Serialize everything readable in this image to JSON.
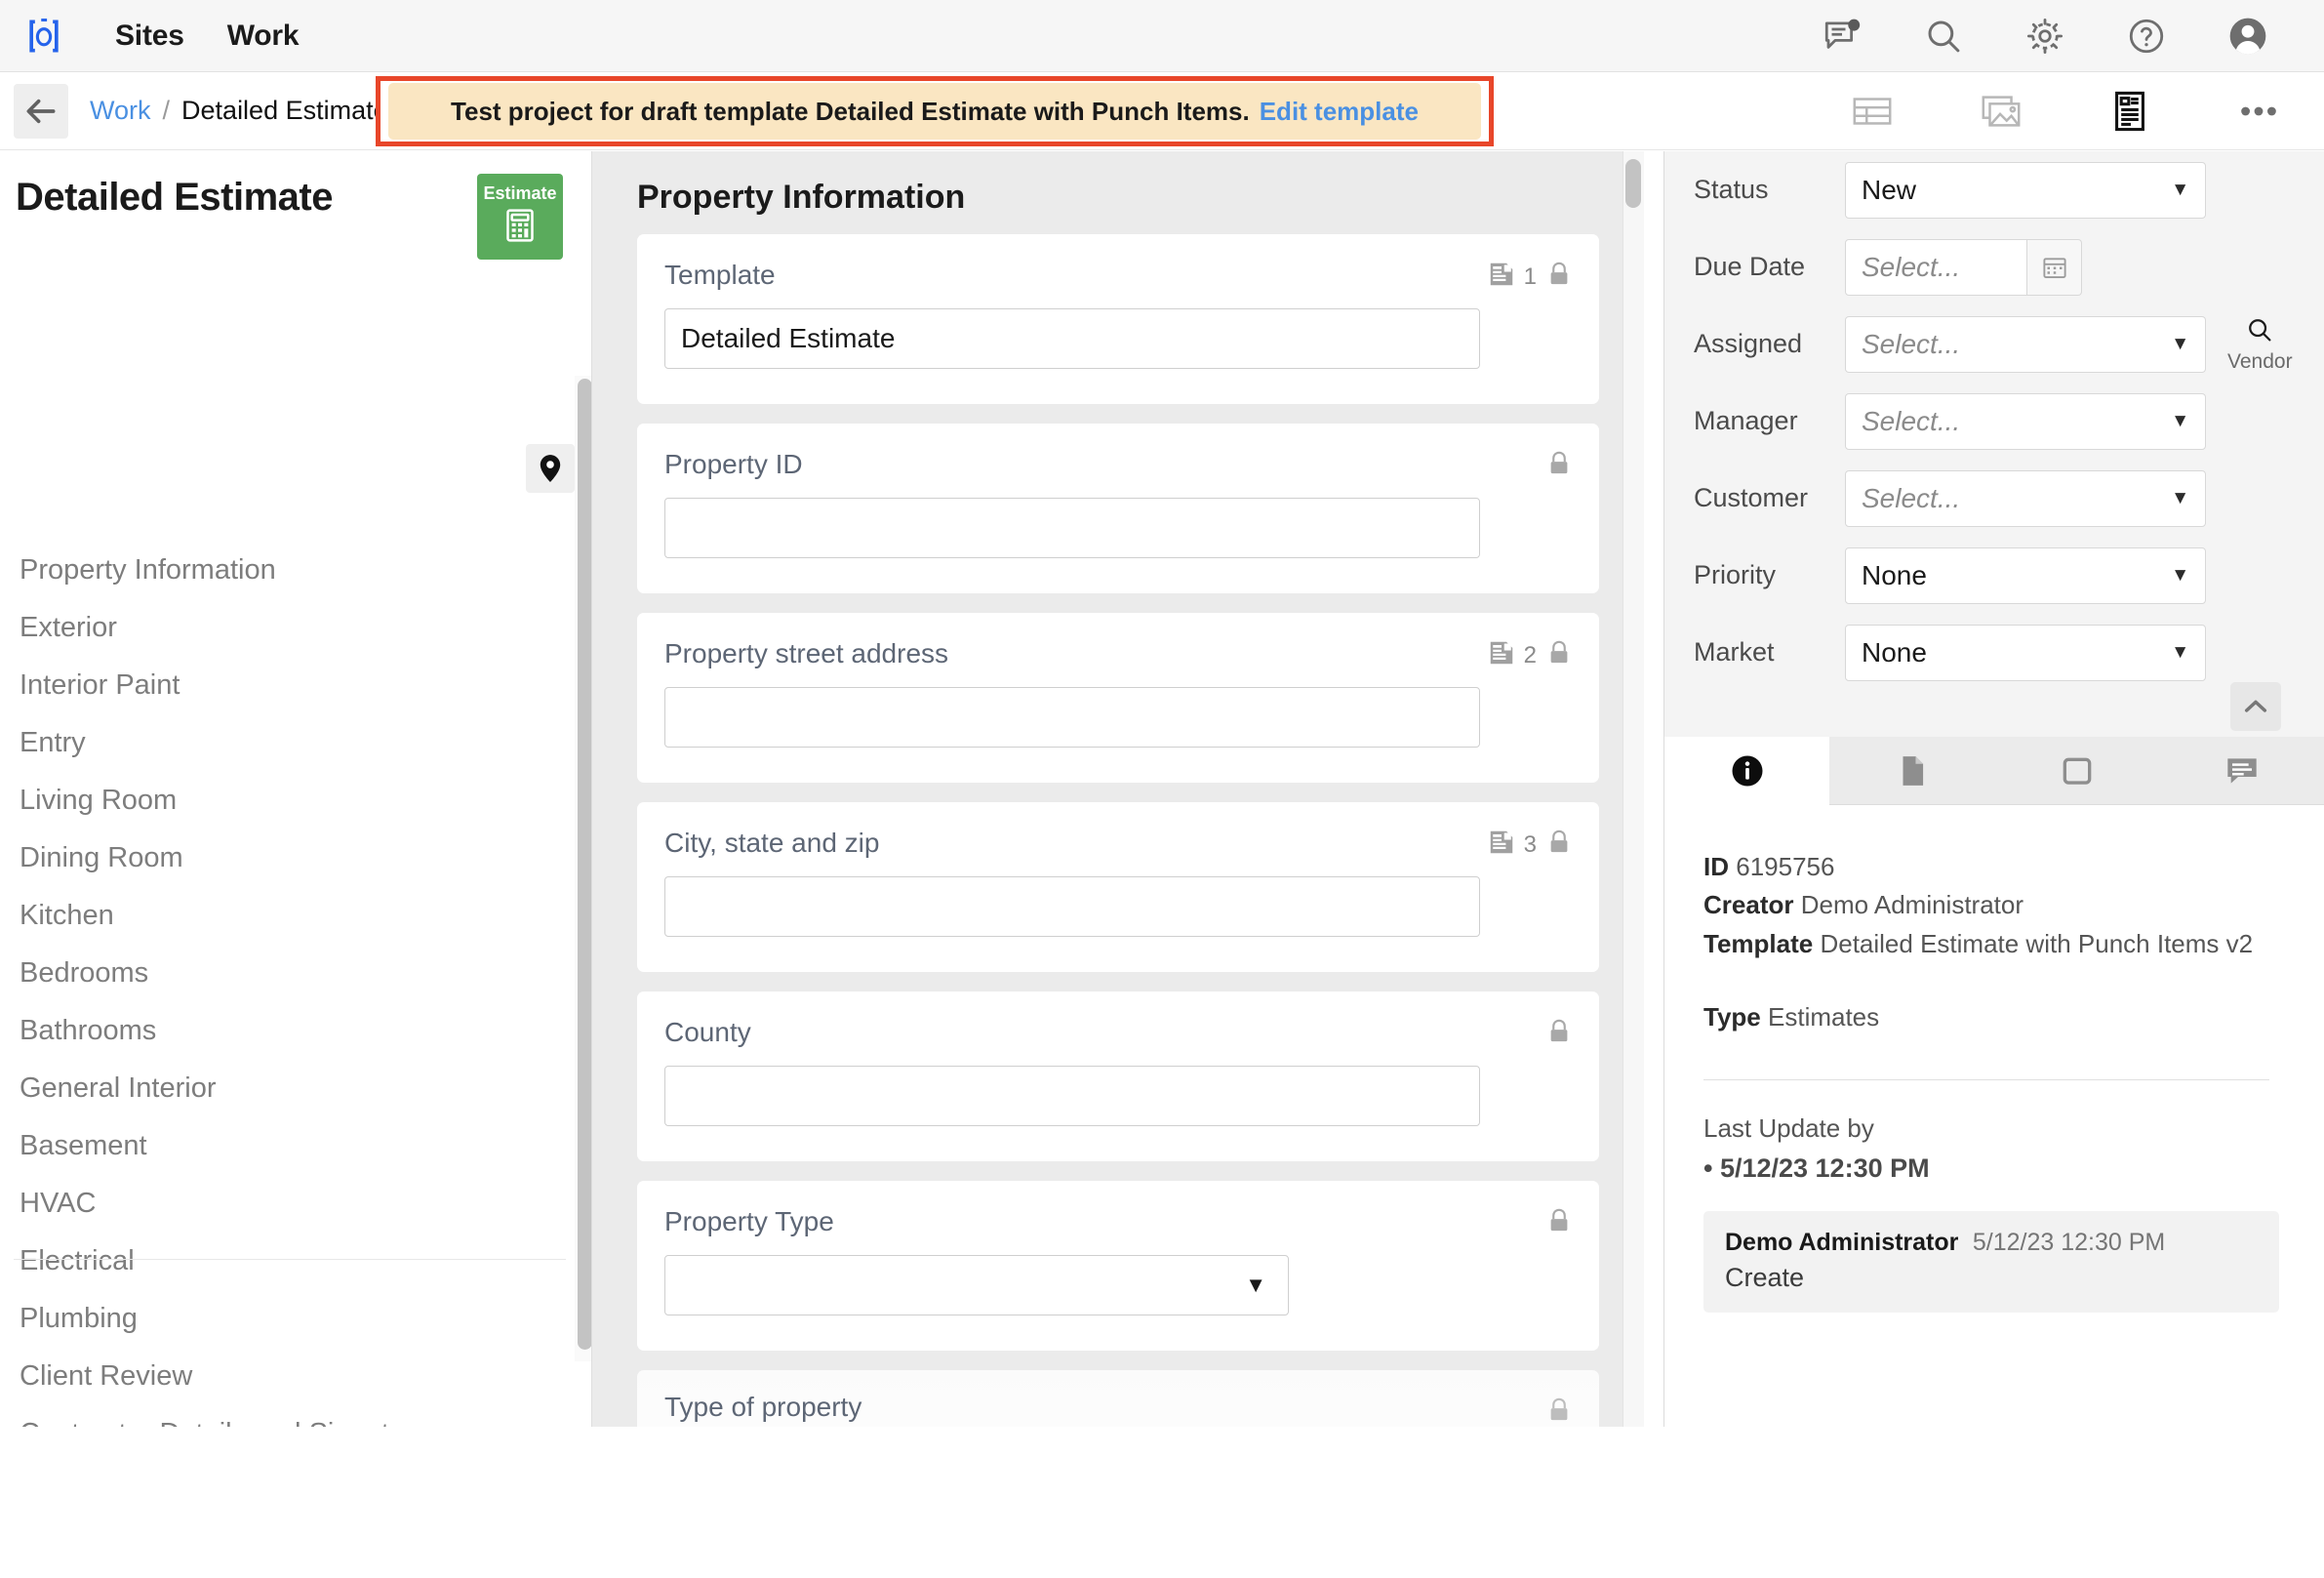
{
  "topbar": {
    "brand_icon": "bracket-o-logo",
    "nav": [
      {
        "label": "Sites",
        "name": "nav-sites"
      },
      {
        "label": "Work",
        "name": "nav-work"
      }
    ],
    "icons": [
      {
        "name": "messages-icon",
        "badge": true
      },
      {
        "name": "search-icon",
        "badge": false
      },
      {
        "name": "gear-icon",
        "badge": false
      },
      {
        "name": "help-icon",
        "badge": false
      },
      {
        "name": "avatar-icon",
        "badge": false
      }
    ]
  },
  "breadcrumb": {
    "back_icon": "arrow-left-icon",
    "parent": "Work",
    "separator": "/",
    "current": "Detailed Estimate"
  },
  "banner": {
    "text": "Test project for draft template Detailed Estimate with Punch Items.",
    "link": "Edit template",
    "border_color": "#e8462a",
    "background_color": "#fae6c2"
  },
  "view_toolbar": [
    {
      "name": "table-view-icon",
      "active": false
    },
    {
      "name": "gallery-view-icon",
      "active": false
    },
    {
      "name": "form-view-icon",
      "active": true
    },
    {
      "name": "more-options-icon",
      "active": false
    }
  ],
  "sidebar": {
    "title": "Detailed Estimate",
    "estimate_badge": {
      "label": "Estimate",
      "icon": "calculator-icon",
      "color": "#5aab5c"
    },
    "pin_icon": "location-pin-icon",
    "items": [
      {
        "label": "Property Information"
      },
      {
        "label": "Exterior"
      },
      {
        "label": "Interior Paint"
      },
      {
        "label": "Entry"
      },
      {
        "label": "Living Room"
      },
      {
        "label": "Dining Room"
      },
      {
        "label": "Kitchen"
      },
      {
        "label": "Bedrooms"
      },
      {
        "label": "Bathrooms"
      },
      {
        "label": "General Interior"
      },
      {
        "label": "Basement"
      },
      {
        "label": "HVAC"
      },
      {
        "label": "Electrical"
      },
      {
        "label": "Plumbing"
      },
      {
        "label": "Client Review"
      },
      {
        "label": "Contractor Details and Signature"
      }
    ]
  },
  "main": {
    "section_title": "Property Information",
    "fields": [
      {
        "label": "Template",
        "type": "text",
        "value": "Detailed Estimate",
        "placeholder": "",
        "note_count": "1",
        "locked": true
      },
      {
        "label": "Property ID",
        "type": "text",
        "value": "",
        "placeholder": "",
        "note_count": "",
        "locked": true
      },
      {
        "label": "Property street address",
        "type": "text",
        "value": "",
        "placeholder": "",
        "note_count": "2",
        "locked": true
      },
      {
        "label": "City, state and zip",
        "type": "text",
        "value": "",
        "placeholder": "",
        "note_count": "3",
        "locked": true
      },
      {
        "label": "County",
        "type": "text",
        "value": "",
        "placeholder": "",
        "note_count": "",
        "locked": true
      },
      {
        "label": "Property Type",
        "type": "select",
        "value": "",
        "placeholder": "",
        "note_count": "",
        "locked": true
      }
    ],
    "partial_field_label": "Type of property"
  },
  "rightpanel": {
    "properties": [
      {
        "label": "Status",
        "type": "select",
        "value": "New",
        "placeholder": ""
      },
      {
        "label": "Due Date",
        "type": "date",
        "value": "",
        "placeholder": "Select..."
      },
      {
        "label": "Assigned",
        "type": "select",
        "value": "",
        "placeholder": "Select...",
        "extra": {
          "icon": "search-icon",
          "label": "Vendor"
        }
      },
      {
        "label": "Manager",
        "type": "select",
        "value": "",
        "placeholder": "Select..."
      },
      {
        "label": "Customer",
        "type": "select",
        "value": "",
        "placeholder": "Select..."
      },
      {
        "label": "Priority",
        "type": "select",
        "value": "None",
        "placeholder": ""
      },
      {
        "label": "Market",
        "type": "select",
        "value": "None",
        "placeholder": ""
      }
    ],
    "collapse_icon": "chevron-up-icon",
    "tabs": [
      {
        "name": "tab-info",
        "icon": "info-icon",
        "active": true
      },
      {
        "name": "tab-documents",
        "icon": "document-icon",
        "active": false
      },
      {
        "name": "tab-board",
        "icon": "window-icon",
        "active": false
      },
      {
        "name": "tab-comments",
        "icon": "comment-icon",
        "active": false
      }
    ],
    "info": {
      "id_label": "ID",
      "id_value": "6195756",
      "creator_label": "Creator",
      "creator_value": "Demo Administrator",
      "template_label": "Template",
      "template_value": "Detailed Estimate with Punch Items v2",
      "type_label": "Type",
      "type_value": "Estimates"
    },
    "last_update": {
      "title": "Last Update by",
      "date": "• 5/12/23 12:30 PM",
      "entry_who": "Demo Administrator",
      "entry_when": "5/12/23 12:30 PM",
      "entry_action": "Create"
    }
  }
}
